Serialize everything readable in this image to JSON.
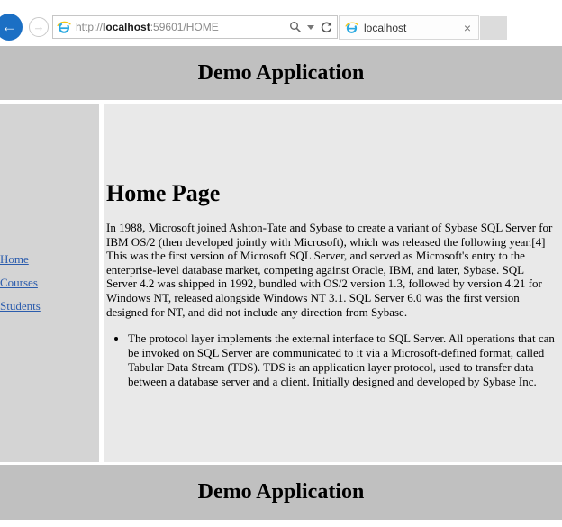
{
  "browser": {
    "back_icon": "←",
    "forward_icon": "→",
    "url": {
      "scheme": "http://",
      "host": "localhost",
      "rest": ":59601/HOME"
    },
    "tab": {
      "title": "localhost",
      "close_label": "×"
    }
  },
  "header": {
    "title": "Demo Application"
  },
  "sidebar": {
    "links": [
      {
        "label": "Home"
      },
      {
        "label": "Courses"
      },
      {
        "label": "Students"
      }
    ]
  },
  "main": {
    "heading": "Home Page",
    "paragraph": "In 1988, Microsoft joined Ashton-Tate and Sybase to create a variant of Sybase SQL Server for IBM OS/2 (then developed jointly with Microsoft), which was released the following year.[4] This was the first version of Microsoft SQL Server, and served as Microsoft's entry to the enterprise-level database market, competing against Oracle, IBM, and later, Sybase. SQL Server 4.2 was shipped in 1992, bundled with OS/2 version 1.3, followed by version 4.21 for Windows NT, released alongside Windows NT 3.1. SQL Server 6.0 was the first version designed for NT, and did not include any direction from Sybase.",
    "bullets": [
      {
        "text": "The protocol layer implements the external interface to SQL Server. All operations that can be invoked on SQL Server are communicated to it via a Microsoft-defined format, called Tabular Data Stream (TDS). TDS is an application layer protocol, used to transfer data between a database server and a client. Initially designed and developed by Sybase Inc."
      }
    ]
  },
  "footer": {
    "title": "Demo Application"
  },
  "colors": {
    "banner_gray": "#c0c0c0",
    "sidebar_gray": "#d4d4d4",
    "content_gray": "#e9e9e9",
    "link_blue": "#2b5cad",
    "back_button_blue": "#1b6fc4",
    "ie_blue": "#2aa9e0",
    "ie_yellow": "#f3c613"
  }
}
